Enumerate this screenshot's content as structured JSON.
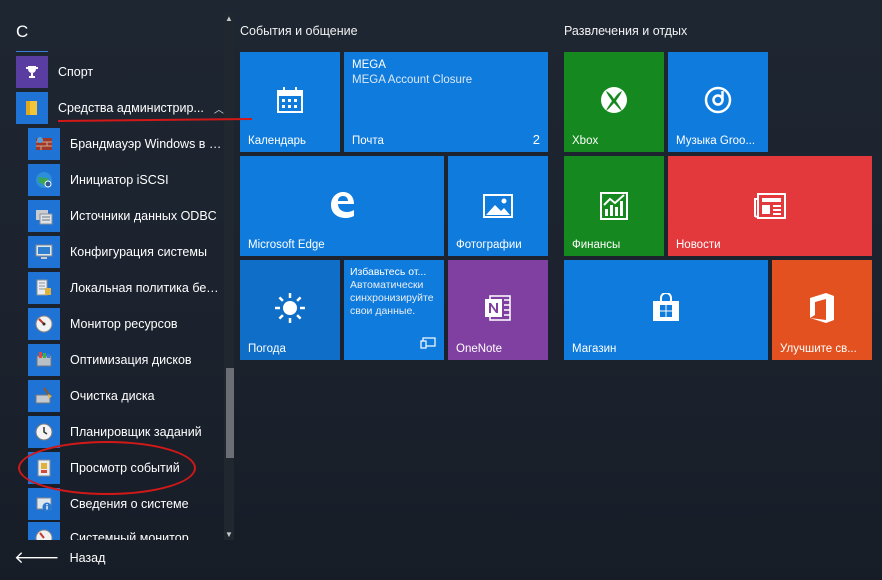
{
  "list": {
    "letter": "С",
    "top_items": [
      {
        "label": "Спорт",
        "icon": "trophy-icon"
      },
      {
        "label": "Средства администрир...",
        "icon": "folder-icon",
        "expanded": true
      }
    ],
    "sub_items": [
      {
        "label": "Брандмауэр Windows в ре...",
        "icon": "firewall-icon"
      },
      {
        "label": "Инициатор iSCSI",
        "icon": "globe-icon"
      },
      {
        "label": "Источники данных ODBC",
        "icon": "database-icon"
      },
      {
        "label": "Конфигурация системы",
        "icon": "monitor-icon"
      },
      {
        "label": "Локальная политика безо...",
        "icon": "security-policy-icon"
      },
      {
        "label": "Монитор ресурсов",
        "icon": "gauge-icon"
      },
      {
        "label": "Оптимизация дисков",
        "icon": "disk-optimize-icon"
      },
      {
        "label": "Очистка диска",
        "icon": "disk-cleanup-icon"
      },
      {
        "label": "Планировщик заданий",
        "icon": "clock-icon"
      },
      {
        "label": "Просмотр событий",
        "icon": "event-viewer-icon"
      },
      {
        "label": "Сведения о системе",
        "icon": "info-icon"
      },
      {
        "label": "Системный монитор",
        "icon": "perf-monitor-icon"
      }
    ],
    "back_label": "Назад"
  },
  "groups": {
    "social_title": "События и общение",
    "entertainment_title": "Развлечения и отдых"
  },
  "tiles": {
    "calendar": "Календарь",
    "mail_app": "MEGA",
    "mail_subject": "MEGA Account Closure",
    "mail_label": "Почта",
    "mail_count": "2",
    "edge": "Microsoft Edge",
    "photos": "Фотографии",
    "weather": "Погода",
    "news_title": "Избавьтесь от...",
    "news_body": "Автоматически синхронизируйте свои данные.",
    "onenote": "OneNote",
    "xbox": "Xbox",
    "groove": "Музыка Groo...",
    "finance": "Финансы",
    "news": "Новости",
    "store": "Магазин",
    "office": "Улучшите св..."
  },
  "colors": {
    "accent_blue": "#0f7bdc",
    "green": "#15891f",
    "red": "#e3393d",
    "purple": "#8040a1",
    "orange": "#e2511f",
    "annotation": "#d31818"
  }
}
